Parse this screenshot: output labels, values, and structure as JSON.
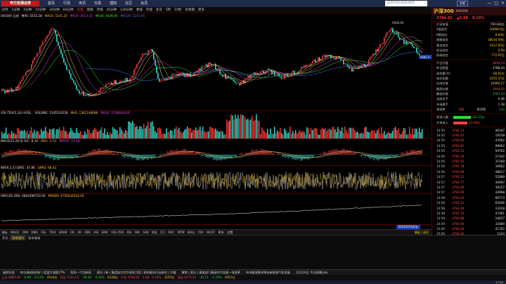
{
  "app": {
    "logo": "申万宏源证券",
    "menu": [
      "首页",
      "行情",
      "资讯",
      "交易",
      "理财",
      "社区",
      "会员"
    ],
    "search_placeholder": "证券代码/名称/拼音",
    "header_button": "交易",
    "window_controls": [
      "—",
      "□",
      "×"
    ]
  },
  "periods": [
    "分时",
    "1分钟",
    "5分钟",
    "15分钟",
    "30分钟",
    "60分钟",
    "日线",
    "周线",
    "月线",
    "45分钟",
    "120分钟",
    "季线",
    "年线",
    "多日",
    "5秒",
    "10秒",
    "多周期",
    "更多"
  ],
  "active_period": "日线",
  "main_pane": {
    "title_ma": "MA5: 5151.18",
    "title_parts": [
      {
        "label": "000300 日线",
        "color": "#e0e0e0"
      },
      {
        "label": "MA5: 5151.18",
        "color": "#ffffff"
      },
      {
        "label": "MA10: 5141.20",
        "color": "#ffcc33"
      },
      {
        "label": "MA20: 5013.42",
        "color": "#ff40ff"
      },
      {
        "label": "MA30: 5036.60",
        "color": "#33ff33"
      },
      {
        "label": "MA120: 5242.05",
        "color": "#5080ff"
      }
    ],
    "peak_label": "5930.91",
    "last_tag": "3081.4"
  },
  "vol_pane": {
    "title_parts": [
      {
        "label": "VOL-TDX(5,10) VVOL:",
        "color": "#e0e0e0"
      },
      {
        "label": "VOLUME: 1545510556",
        "color": "#e0e0e0"
      },
      {
        "label": "MA5: 1361148098",
        "color": "#ffcc33"
      },
      {
        "label": "MA10: 1558944330",
        "color": "#ff40ff"
      }
    ]
  },
  "macd_pane": {
    "title_parts": [
      {
        "label": "MACD(12,26,9) DIF: -8.30",
        "color": "#e0e0e0"
      },
      {
        "label": "DEA: -2.51",
        "color": "#ffcc33"
      },
      {
        "label": "MACD: -11.58",
        "color": "#ff40ff"
      }
    ]
  },
  "wr_pane": {
    "title_parts": [
      {
        "label": "WR(9,3,3) LWR1: 47.86",
        "color": "#e0e0e0"
      },
      {
        "label": "LWR2: 68.42",
        "color": "#ffcc33"
      }
    ]
  },
  "obv_pane": {
    "title_parts": [
      {
        "label": "OBV(30) OBV: 4803496720.00",
        "color": "#e0e0e0"
      },
      {
        "label": "MAOBV: 4756434324.00",
        "color": "#ffcc33"
      }
    ]
  },
  "time_axis": {
    "date_tag": "2021/07/16/五"
  },
  "indicators": [
    "指标",
    "MACD",
    "DMI",
    "DMA",
    "FSL",
    "TRIX",
    "BRAR",
    "CR",
    "VR",
    "OBV",
    "ASI",
    "EMV",
    "VOL-TDX",
    "RSI",
    "WR",
    "SAR",
    "KDJ",
    "CCI",
    "ROC",
    "MTM",
    "BOLL",
    "PSY",
    "MCST",
    "更多",
    "设置"
  ],
  "indicator_sub": "模板 | 选项",
  "news": {
    "tabs": [
      "资讯",
      "财报通讯",
      "股东增减"
    ],
    "active": "财报通讯"
  },
  "ticker": [
    "迷财讯息",
    "央企调结构利好 | 蓝盘大涨超17%",
    "股份一个月新高",
    "视光 | 新 | 集团加大芯片研发力度 | 机构股东行业研究 | 大幅",
    "聚焦 | 股分 | 通道部门精英时代加速一场变革",
    "市场看涨需求增长新能源汽车发展",
    "11月16日 今日直播分析"
  ],
  "statusbar": [
    {
      "text": "上证 3083.40",
      "color": "#ff5050"
    },
    {
      "text": "-9.89",
      "color": "#33dd33"
    },
    {
      "text": "-0.13%",
      "color": "#33dd33"
    },
    {
      "text": "4534亿",
      "color": "#ffcc33"
    },
    {
      "text": "深证 13113.5",
      "color": "#ff5050"
    },
    {
      "text": "-26.30",
      "color": "#33dd33"
    },
    {
      "text": "-0.24%",
      "color": "#33dd33"
    },
    {
      "text": "6128亿",
      "color": "#ffcc33"
    },
    {
      "text": "沪深 3794.02",
      "color": "#ff5050"
    },
    {
      "text": "5.58",
      "color": "#ff5050"
    },
    {
      "text": "0.15%",
      "color": "#ff5050"
    },
    {
      "text": "3155亿",
      "color": "#ffcc33"
    },
    {
      "text": "创业 2275.21",
      "color": "#ff5050"
    },
    {
      "text": "-30.11",
      "color": "#33dd33"
    },
    {
      "text": "-1.25%",
      "color": "#33dd33"
    },
    {
      "text": "2051亿",
      "color": "#ffcc33"
    }
  ],
  "clock": "17:55",
  "stock": {
    "name": "沪深300",
    "code": "000300",
    "price": "3794.02",
    "change": "▲5.58",
    "pct": "0.15%",
    "fields_a": [
      {
        "k": "沪深市值",
        "v": "791183亿",
        "c": "w"
      },
      {
        "k": "A股成交",
        "v": "10668.6亿",
        "c": "y"
      },
      {
        "k": "B股成交",
        "v": "8.83亿",
        "c": "y"
      },
      {
        "k": "国债成交",
        "v": "18016.59亿",
        "c": "y"
      },
      {
        "k": "基金成交",
        "v": "1417.83亿",
        "c": "y"
      },
      {
        "k": "权证成交",
        "v": "0.00",
        "c": "y"
      },
      {
        "k": "债券成交",
        "v": "772.97亿",
        "c": "y"
      }
    ],
    "fields_b": [
      {
        "k": "今日开盘",
        "v": "3818.14",
        "c": "r"
      },
      {
        "k": "昨日收盘",
        "v": "3788.44",
        "c": "w"
      },
      {
        "k": "成交量(手)",
        "v": "66.61亿",
        "c": "y"
      },
      {
        "k": "成交金额",
        "v": "3155.37亿",
        "c": "y"
      },
      {
        "k": "总成交笔",
        "v": "16966.57",
        "c": "y"
      },
      {
        "k": "最高价格",
        "v": "3848.45",
        "c": "r"
      },
      {
        "k": "最低价格",
        "v": "3787.13",
        "c": "g"
      },
      {
        "k": "当前总手",
        "v": "0.46",
        "c": "w"
      },
      {
        "k": "市场换手",
        "v": "1.38",
        "c": "w"
      }
    ],
    "rise_fall": {
      "up_label": "涨家数",
      "up": "168",
      "down_label": "跌家数",
      "down": "132"
    },
    "flows": [
      {
        "k": "净流入额",
        "v": "-16.53亿",
        "color": "#33dd33",
        "w": 0.25
      },
      {
        "k": "大单流入",
        "v": "13.69亿",
        "color": "#ff4040",
        "w": 0.2
      }
    ],
    "ticks": [
      {
        "t": "14:55",
        "p": "3792.13",
        "q": "46187"
      },
      {
        "t": "14:55",
        "p": "3792.45",
        "q": "18158"
      },
      {
        "t": "14:55",
        "p": "3792.65",
        "q": "47002"
      },
      {
        "t": "14:55",
        "p": "3792.92",
        "q": "98062"
      },
      {
        "t": "14:55",
        "p": "3793.12",
        "q": "50762"
      },
      {
        "t": "14:56",
        "p": "3792.56",
        "q": "27342"
      },
      {
        "t": "14:56",
        "p": "3792.55",
        "q": "31568"
      },
      {
        "t": "14:56",
        "p": "3792.78",
        "q": "39062"
      },
      {
        "t": "14:56",
        "p": "3792.99",
        "q": "48617"
      },
      {
        "t": "14:57",
        "p": "3793.21",
        "q": "52089"
      },
      {
        "t": "14:57",
        "p": "3792.77",
        "q": "40997"
      },
      {
        "t": "14:57",
        "p": "3792.66",
        "q": "38157"
      },
      {
        "t": "14:57",
        "p": "3792.80",
        "q": "42898"
      },
      {
        "t": "14:58",
        "p": "3793.03",
        "q": "80773"
      },
      {
        "t": "14:58",
        "p": "3793.31",
        "q": "65046"
      },
      {
        "t": "14:58",
        "p": "3793.49",
        "q": "24318"
      },
      {
        "t": "14:58",
        "p": "3793.70",
        "q": "47061"
      },
      {
        "t": "14:59",
        "p": "3793.88",
        "q": "18457"
      },
      {
        "t": "14:59",
        "p": "3793.95",
        "q": "32089"
      },
      {
        "t": "15:00",
        "p": "3794.02",
        "q": "41762"
      },
      {
        "t": "15:00",
        "p": "3794.02",
        "q": "1224"
      }
    ]
  },
  "colors": {
    "up": "#ff3838",
    "down": "#33ddcc",
    "ma5": "#ffffff",
    "ma10": "#ffcc33",
    "ma20": "#ff40ff",
    "ma30": "#33ff33",
    "ma120": "#5080ff"
  }
}
